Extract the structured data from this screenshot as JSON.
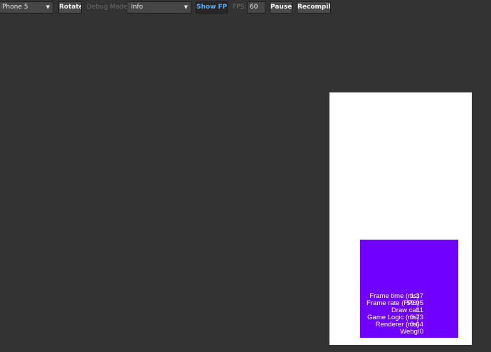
{
  "toolbar": {
    "device_select": "Phone 5",
    "rotate_label": "Rotate",
    "debug_mode_label": "Debug Mode:",
    "debug_mode_select": "Info",
    "show_fps_label": "Show FPS",
    "fps_label": "FPS:",
    "fps_value": "60",
    "pause_label": "Pause",
    "recompile_label": "Recompile"
  },
  "stats": [
    {
      "label": "Frame time (ms)",
      "value": "1.37"
    },
    {
      "label": "Frame rate (FPS)",
      "value": "59.95"
    },
    {
      "label": "Draw call",
      "value": "11"
    },
    {
      "label": "Game Logic (ms)",
      "value": "0.73"
    },
    {
      "label": "Renderer (ms)",
      "value": "0.64"
    },
    {
      "label": "Webgl",
      "value": "0"
    }
  ],
  "colors": {
    "background": "#333333",
    "box": "#7000ff",
    "active_button_text": "#5ab0ff"
  }
}
